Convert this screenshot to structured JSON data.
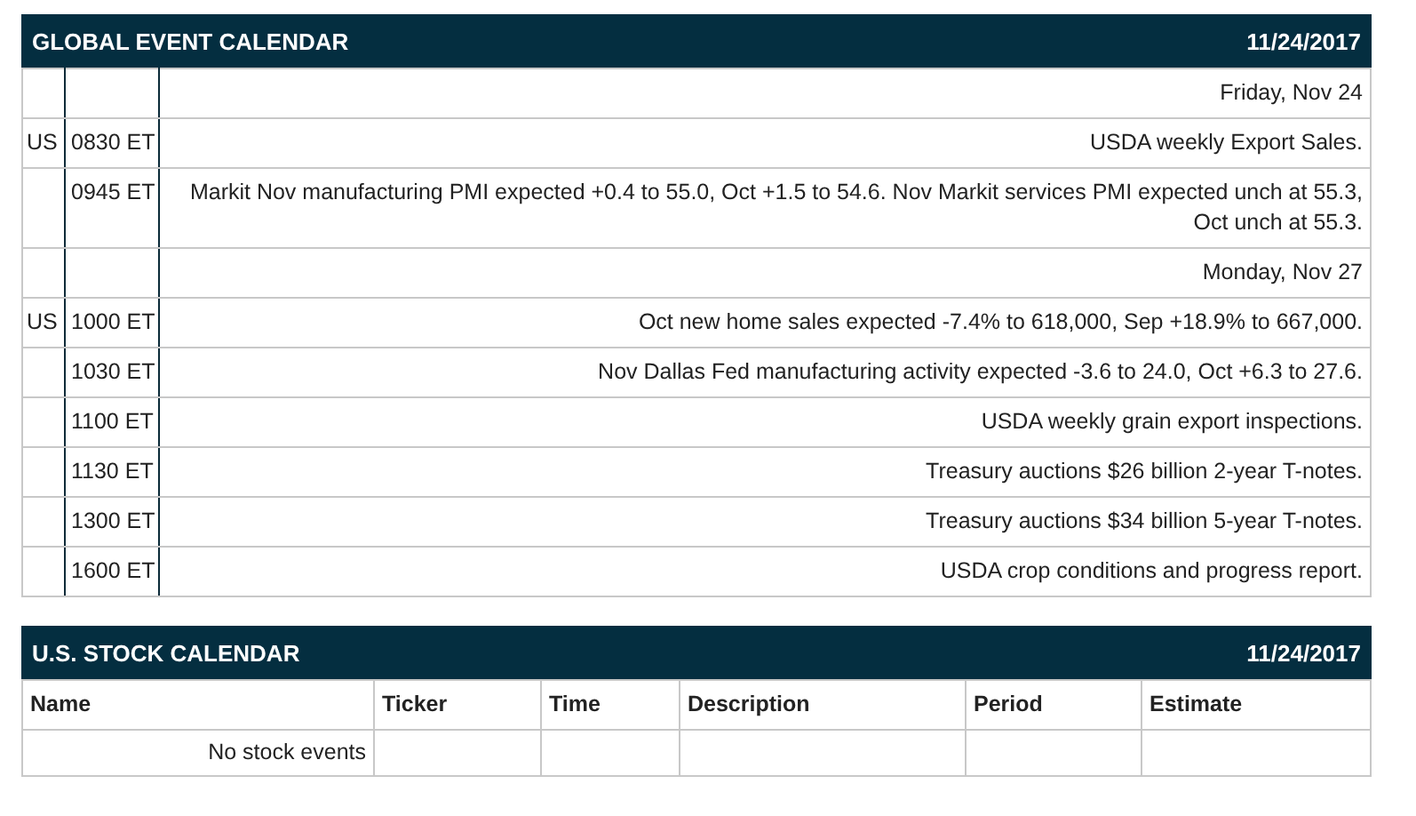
{
  "global_calendar": {
    "title": "GLOBAL EVENT CALENDAR",
    "date": "11/24/2017",
    "rows": [
      {
        "kind": "date",
        "text": "Friday, Nov 24"
      },
      {
        "kind": "event",
        "region": "US",
        "time": "0830 ET",
        "description": "USDA weekly Export Sales."
      },
      {
        "kind": "event",
        "time": "0945 ET",
        "description": "Markit Nov manufacturing PMI expected +0.4 to 55.0, Oct +1.5 to 54.6. Nov Markit services PMI expected unch at 55.3, Oct unch at 55.3."
      },
      {
        "kind": "date",
        "text": "Monday, Nov 27"
      },
      {
        "kind": "event",
        "region": "US",
        "time": "1000 ET",
        "description": "Oct new home sales expected -7.4% to 618,000, Sep +18.9% to 667,000."
      },
      {
        "kind": "event",
        "time": "1030 ET",
        "description": "Nov Dallas Fed manufacturing activity expected -3.6 to 24.0, Oct +6.3 to 27.6."
      },
      {
        "kind": "event",
        "time": "1100 ET",
        "description": "USDA weekly grain export inspections."
      },
      {
        "kind": "event",
        "time": "1130 ET",
        "description": "Treasury auctions $26 billion 2-year T-notes."
      },
      {
        "kind": "event",
        "time": "1300 ET",
        "description": "Treasury auctions $34 billion 5-year T-notes."
      },
      {
        "kind": "event",
        "time": "1600 ET",
        "description": "USDA crop conditions and progress report."
      }
    ]
  },
  "stock_calendar": {
    "title": "U.S. STOCK CALENDAR",
    "date": "11/24/2017",
    "columns": [
      "Name",
      "Ticker",
      "Time",
      "Description",
      "Period",
      "Estimate"
    ],
    "rows": [
      {
        "text": "No stock events"
      }
    ]
  }
}
